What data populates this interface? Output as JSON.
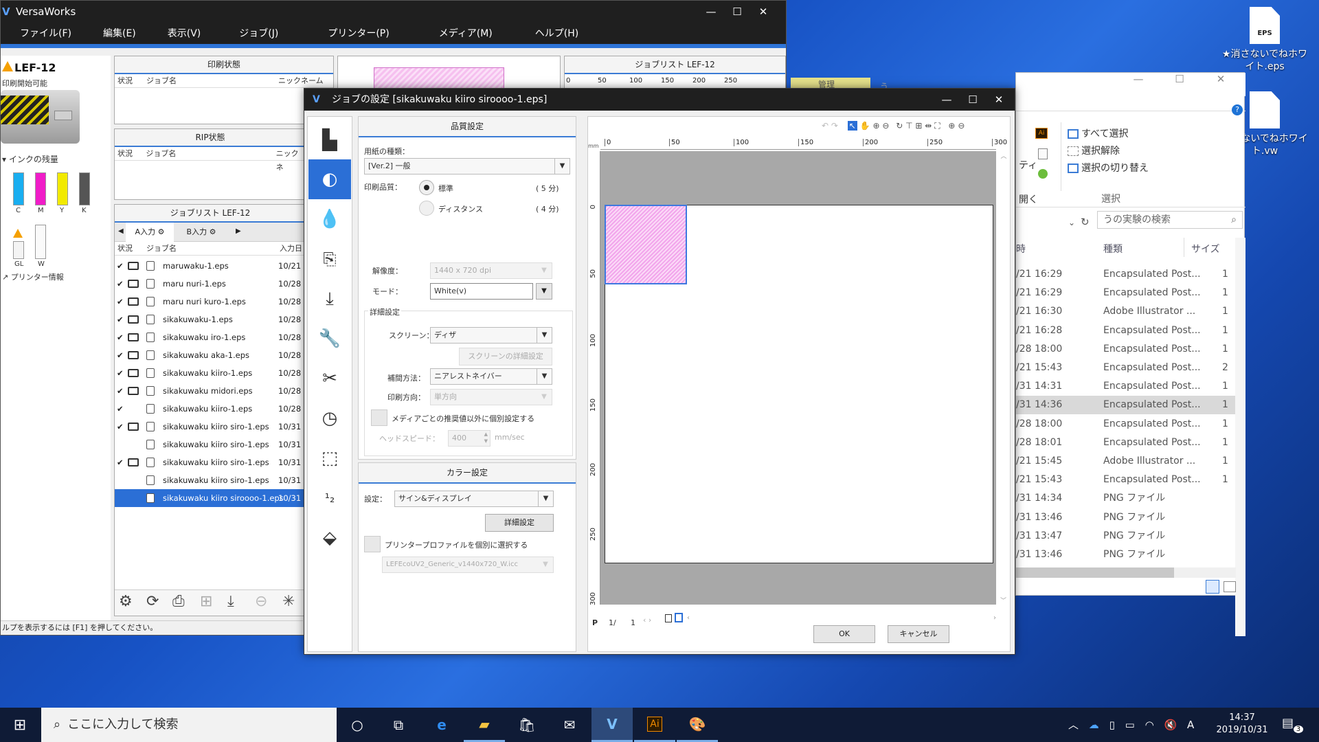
{
  "desktop": {
    "icons": [
      {
        "label": "★消さないでねホワイト.eps",
        "badge": "EPS"
      },
      {
        "label": "消さないでねホワイト.vw"
      }
    ]
  },
  "versaworks": {
    "title": "VersaWorks",
    "menu": [
      "ファイル(F)",
      "編集(E)",
      "表示(V)",
      "ジョブ(J)",
      "プリンター(P)",
      "メディア(M)",
      "ヘルプ(H)"
    ],
    "printer": {
      "name": "LEF-12",
      "status": "印刷開始可能"
    },
    "ink": {
      "header": "インクの残量",
      "colors": [
        {
          "label": "C",
          "color": "#19aef0"
        },
        {
          "label": "M",
          "color": "#f01cc8"
        },
        {
          "label": "Y",
          "color": "#f2ea00"
        },
        {
          "label": "K",
          "color": "#555555"
        }
      ],
      "extra": [
        {
          "label": "GL"
        },
        {
          "label": "W"
        }
      ]
    },
    "printer_info": "プリンター情報",
    "print_status": {
      "title": "印刷状態",
      "cols": [
        "状況",
        "ジョブ名",
        "ニックネーム"
      ]
    },
    "rip_status": {
      "title": "RIP状態",
      "cols": [
        "状況",
        "ジョブ名",
        "ニックネ"
      ]
    },
    "joblist_left": {
      "title": "ジョブリスト LEF-12",
      "tab_a": "A入力",
      "tab_b": "B入力",
      "cols": [
        "状況",
        "ジョブ名",
        "入力日"
      ]
    },
    "jobs": [
      {
        "check": "✔",
        "printed": true,
        "name": "maruwaku-1.eps",
        "date": "10/21"
      },
      {
        "check": "✔",
        "printed": true,
        "name": "maru nuri-1.eps",
        "date": "10/28"
      },
      {
        "check": "✔",
        "printed": true,
        "name": "maru nuri kuro-1.eps",
        "date": "10/28"
      },
      {
        "check": "✔",
        "printed": true,
        "name": "sikakuwaku-1.eps",
        "date": "10/28"
      },
      {
        "check": "✔",
        "printed": true,
        "name": "sikakuwaku iro-1.eps",
        "date": "10/28"
      },
      {
        "check": "✔",
        "printed": true,
        "name": "sikakuwaku aka-1.eps",
        "date": "10/28"
      },
      {
        "check": "✔",
        "printed": true,
        "name": "sikakuwaku kiiro-1.eps",
        "date": "10/28"
      },
      {
        "check": "✔",
        "printed": true,
        "name": "sikakuwaku midori.eps",
        "date": "10/28"
      },
      {
        "check": "✔",
        "printed": false,
        "name": "sikakuwaku kiiro-1.eps",
        "date": "10/28"
      },
      {
        "check": "✔",
        "printed": true,
        "name": "sikakuwaku kiiro siro-1.eps",
        "date": "10/31"
      },
      {
        "check": "",
        "printed": false,
        "name": "sikakuwaku kiiro siro-1.eps",
        "date": "10/31"
      },
      {
        "check": "✔",
        "printed": true,
        "name": "sikakuwaku kiiro siro-1.eps",
        "date": "10/31"
      },
      {
        "check": "",
        "printed": false,
        "name": "sikakuwaku kiiro siro-1.eps",
        "date": "10/31"
      },
      {
        "check": "",
        "printed": false,
        "name": "sikakuwaku kiiro siroooo-1.eps",
        "date": "10/31",
        "selected": true
      }
    ],
    "joblist_right": {
      "title": "ジョブリスト LEF-12",
      "ticks": [
        "0",
        "50",
        "100",
        "150",
        "200",
        "250"
      ]
    },
    "statusbar": "ルプを表示するには [F1] を押してください。"
  },
  "dialog": {
    "title": "ジョブの設定 [sikakuwaku kiiro siroooo-1.eps]",
    "quality": {
      "header": "品質設定",
      "media_type_label": "用紙の種類：",
      "media_type": "[Ver.2] 一般",
      "quality_label": "印刷品質：",
      "options": [
        {
          "label": "標準",
          "time": "( 5 分)",
          "selected": true
        },
        {
          "label": "ディスタンス",
          "time": "( 4 分)",
          "selected": false
        }
      ],
      "resolution_label": "解像度：",
      "resolution": "1440 x 720 dpi",
      "mode_label": "モード：",
      "mode": "White(v)",
      "detail_header": "詳細設定",
      "screen_label": "スクリーン：",
      "screen": "ディザ",
      "screen_detail_btn": "スクリーンの詳細設定",
      "interp_label": "補間方法：",
      "interp": "ニアレストネイバー",
      "direction_label": "印刷方向：",
      "direction": "単方向",
      "media_override": "メディアごとの推奨値以外に個別設定する",
      "head_speed_label": "ヘッドスピード：",
      "head_speed": "400",
      "head_speed_unit": "mm/sec"
    },
    "color": {
      "header": "カラー設定",
      "setting_label": "設定：",
      "setting": "サイン&ディスプレイ",
      "detail_btn": "詳細設定",
      "profile_check": "プリンタープロファイルを個別に選択する",
      "profile": "LEFEcoUV2_Generic_v1440x720_W.icc"
    },
    "preview": {
      "h_ticks": [
        "0",
        "50",
        "100",
        "150",
        "200",
        "250",
        "300"
      ],
      "v_ticks": [
        "0",
        "50",
        "100",
        "150",
        "200",
        "250",
        "300"
      ],
      "unit": "mm",
      "page_label": "P",
      "page": "1/",
      "page_total": "1"
    },
    "ok": "OK",
    "cancel": "キャンセル"
  },
  "explorer": {
    "ribbon": {
      "select_all": "すべて選択",
      "deselect": "選択解除",
      "invert": "選択の切り替え",
      "group": "選択",
      "left_frag1": "ティ",
      "left_frag2": "開く"
    },
    "search_placeholder": "うの実験の検索",
    "header_frag": "うの実験",
    "tab_frag": "管理",
    "cols": {
      "date": "時",
      "type": "種類",
      "size": "サイズ"
    },
    "rows": [
      {
        "date": "/21 16:29",
        "type": "Encapsulated Post...",
        "size": "1"
      },
      {
        "date": "/21 16:29",
        "type": "Encapsulated Post...",
        "size": "1"
      },
      {
        "date": "/21 16:30",
        "type": "Adobe Illustrator ...",
        "size": "1"
      },
      {
        "date": "/21 16:28",
        "type": "Encapsulated Post...",
        "size": "1"
      },
      {
        "date": "/28 18:00",
        "type": "Encapsulated Post...",
        "size": "1"
      },
      {
        "date": "/21 15:43",
        "type": "Encapsulated Post...",
        "size": "2"
      },
      {
        "date": "/31 14:31",
        "type": "Encapsulated Post...",
        "size": "1"
      },
      {
        "date": "/31 14:36",
        "type": "Encapsulated Post...",
        "size": "1",
        "selected": true
      },
      {
        "date": "/28 18:00",
        "type": "Encapsulated Post...",
        "size": "1"
      },
      {
        "date": "/28 18:01",
        "type": "Encapsulated Post...",
        "size": "1"
      },
      {
        "date": "/21 15:45",
        "type": "Adobe Illustrator ...",
        "size": "1"
      },
      {
        "date": "/21 15:43",
        "type": "Encapsulated Post...",
        "size": "1"
      },
      {
        "date": "/31 14:34",
        "type": "PNG ファイル",
        "size": ""
      },
      {
        "date": "/31 13:46",
        "type": "PNG ファイル",
        "size": ""
      },
      {
        "date": "/31 13:47",
        "type": "PNG ファイル",
        "size": ""
      },
      {
        "date": "/31 13:46",
        "type": "PNG ファイル",
        "size": ""
      }
    ]
  },
  "taskbar": {
    "search": "ここに入力して検索",
    "time": "14:37",
    "date": "2019/10/31",
    "ime": "A",
    "notif_count": "3"
  }
}
